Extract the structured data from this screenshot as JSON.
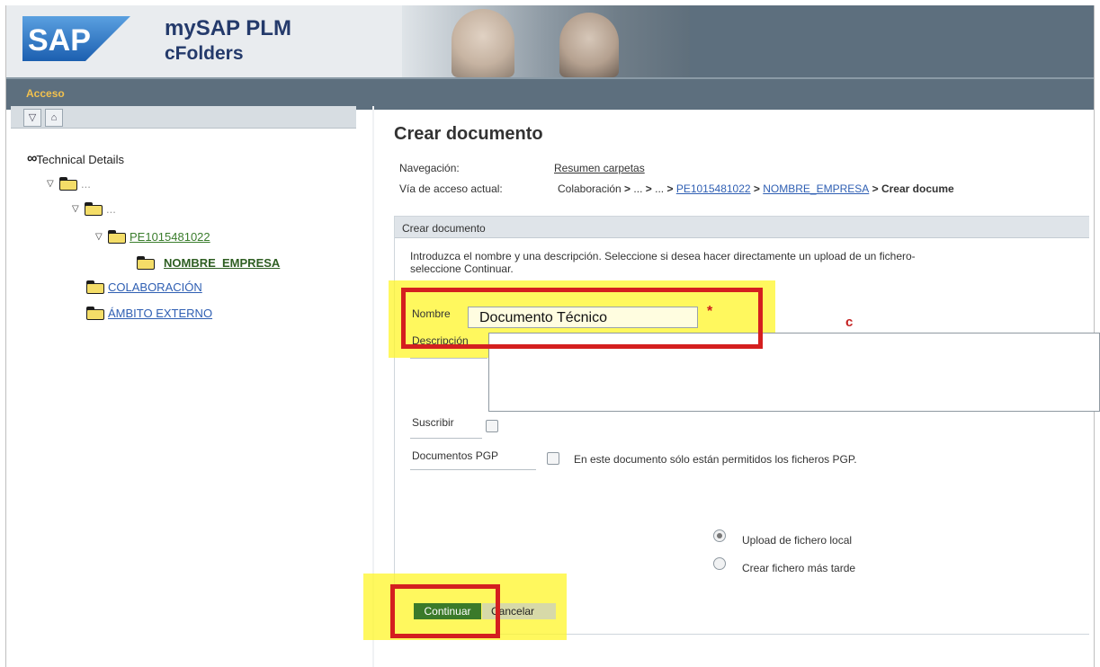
{
  "header": {
    "logo_text": "SAP",
    "product_line1": "mySAP PLM",
    "product_line2": "cFolders",
    "access_label": "Acceso"
  },
  "tree": {
    "root_label": "Technical Details",
    "items": [
      {
        "label": "...",
        "level": 1
      },
      {
        "label": "...",
        "level": 2
      },
      {
        "label": "PE1015481022",
        "level": 3
      },
      {
        "label": "NOMBRE_EMPRESA",
        "level": 4
      },
      {
        "label": "COLABORACIÓN",
        "level": 1
      },
      {
        "label": "ÁMBITO EXTERNO",
        "level": 1
      }
    ]
  },
  "main": {
    "title": "Crear documento",
    "nav_label": "Navegación:",
    "nav_link": "Resumen carpetas",
    "path_label": "Vía de acceso actual:",
    "path_part1": "Colaboración",
    "path_part2": "...",
    "path_part3": "...",
    "path_link1": "PE1015481022",
    "path_link2": "NOMBRE_EMPRESA",
    "path_current": "Crear docume",
    "panel_title": "Crear documento",
    "instructions_line1": "Introduzca el nombre y una descripción. Seleccione si desea hacer directamente un upload de un fichero-",
    "instructions_line2": "seleccione Continuar.",
    "name_label": "Nombre",
    "name_value": "Documento Técnico",
    "required_mark": "*",
    "desc_label": "Descripción",
    "subscribe_label": "Suscribir",
    "pgp_label": "Documentos PGP",
    "pgp_text": "En este documento sólo están permitidos los ficheros PGP.",
    "radio_upload": "Upload de fichero local",
    "radio_later": "Crear fichero más tarde",
    "continue_label": "Continuar",
    "cancel_label": "Cancelar",
    "stray_mark": "c"
  },
  "colors": {
    "highlight": "#fff528",
    "annotation_red": "#d41f1f",
    "continue_green": "#3b7a2a",
    "link_blue": "#2f5fb3"
  }
}
